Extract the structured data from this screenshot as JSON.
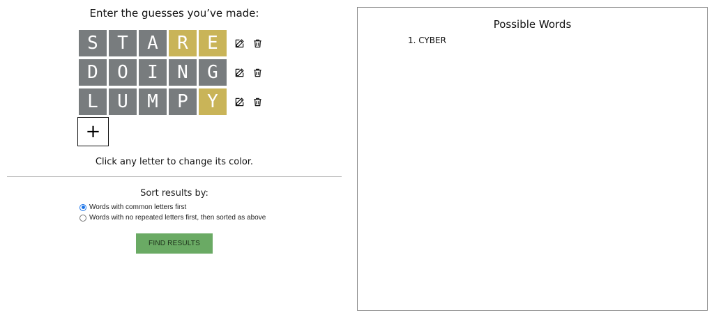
{
  "instructions": "Enter the guesses you’ve made:",
  "guesses": [
    {
      "letters": [
        {
          "char": "S",
          "color": "gray"
        },
        {
          "char": "T",
          "color": "gray"
        },
        {
          "char": "A",
          "color": "gray"
        },
        {
          "char": "R",
          "color": "yellow"
        },
        {
          "char": "E",
          "color": "yellow"
        }
      ]
    },
    {
      "letters": [
        {
          "char": "D",
          "color": "gray"
        },
        {
          "char": "O",
          "color": "gray"
        },
        {
          "char": "I",
          "color": "gray"
        },
        {
          "char": "N",
          "color": "gray"
        },
        {
          "char": "G",
          "color": "gray"
        }
      ]
    },
    {
      "letters": [
        {
          "char": "L",
          "color": "gray"
        },
        {
          "char": "U",
          "color": "gray"
        },
        {
          "char": "M",
          "color": "gray"
        },
        {
          "char": "P",
          "color": "gray"
        },
        {
          "char": "Y",
          "color": "yellow"
        }
      ]
    }
  ],
  "row_actions": {
    "edit_icon": "pencil-icon",
    "delete_icon": "trash-icon"
  },
  "add_button_label": "+",
  "hint": "Click any letter to change its color.",
  "sort": {
    "title": "Sort results by:",
    "options": [
      {
        "label": "Words with common letters first",
        "checked": true
      },
      {
        "label": "Words with no repeated letters first, then sorted as above",
        "checked": false
      }
    ]
  },
  "find_button_label": "FIND RESULTS",
  "results": {
    "title": "Possible Words",
    "words": [
      "1. CYBER"
    ]
  },
  "colors": {
    "gray": "#787c7e",
    "yellow": "#c9b458",
    "green_button": "#6aaa64"
  }
}
